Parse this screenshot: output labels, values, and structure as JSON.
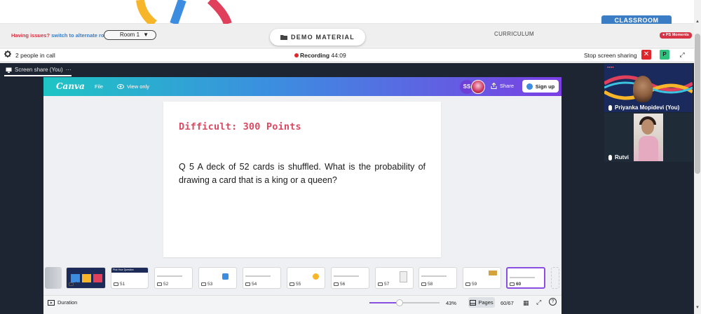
{
  "banner": {
    "classroom_tab": "CLASSROOM",
    "issues_text": "Having issues?",
    "switch_link": "switch to alternate room",
    "room_select": "Room 1",
    "demo_material": "DEMO MATERIAL",
    "curriculum": "CURRICULUM",
    "ps_moments": "PS Moments"
  },
  "callbar": {
    "people": "2 people in call",
    "recording_label": "Recording",
    "recording_time": "44:09",
    "stop_sharing": "Stop screen sharing",
    "stop_x": "✕",
    "participant_initial": "P",
    "expand": "⤢"
  },
  "screenshare": {
    "label": "Screen share (You)",
    "more": "···"
  },
  "canva": {
    "logo": "Canva",
    "file": "File",
    "view_only": "View only",
    "avatar_initials": "SS",
    "share": "Share",
    "sign_up": "Sign up"
  },
  "slide": {
    "title": "Difficult: 300 Points",
    "question": "Q 5 A deck of 52 cards is shuffled. What is the probability of drawing a card that is a king or a queen?"
  },
  "filmstrip": {
    "numbers": [
      "50",
      "51",
      "52",
      "53",
      "54",
      "55",
      "56",
      "57",
      "58",
      "59",
      "60"
    ],
    "first_thumb_title": "Pick Your Question",
    "selected": "60"
  },
  "bottombar": {
    "duration": "Duration",
    "zoom": "43%",
    "zoom_fraction": 0.43,
    "pages": "Pages",
    "page_count": "60/67",
    "help": "?"
  },
  "participants": {
    "tile1_name": "Priyanka Mopidevi (You)",
    "tile2_name": "Rutvi"
  },
  "colors": {
    "accent_purple": "#8a4ee0",
    "recording_red": "#e0262d",
    "title_pink": "#d94a62",
    "brand_blue": "#3b7dc4"
  }
}
